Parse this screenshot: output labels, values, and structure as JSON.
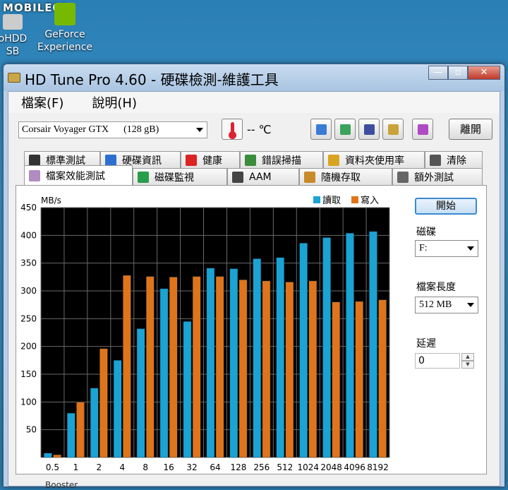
{
  "desktop": {
    "watermark": "MOBILE01",
    "icons": [
      {
        "label_line1": "oHDD",
        "label_line2": "SB"
      },
      {
        "label_line1": "GeForce",
        "label_line2": "Experience"
      }
    ],
    "bottom_text": "Booster"
  },
  "window": {
    "title": "HD Tune Pro 4.60 - 硬碟檢測-維護工具",
    "buttons": {
      "minimize": "—",
      "maximize": "▫",
      "close": "✕"
    }
  },
  "menu": [
    "檔案(F)",
    "說明(H)"
  ],
  "toolbar": {
    "drive": "Corsair Voyager GTX      (128 gB)",
    "temperature": "-- ℃",
    "exit_label": "離開",
    "icon_colors": [
      "#3a7bd5",
      "#3aa35a",
      "#3d4f9e",
      "#c9a23a",
      "#b04ac4"
    ]
  },
  "tabs_top": [
    {
      "label": "標準測試",
      "icon": "trophy-icon"
    },
    {
      "label": "硬碟資訊",
      "icon": "info-icon"
    },
    {
      "label": "健康",
      "icon": "health-cross-icon"
    },
    {
      "label": "錯誤掃描",
      "icon": "magnifier-icon"
    },
    {
      "label": "資料夾使用率",
      "icon": "folder-icon"
    },
    {
      "label": "清除",
      "icon": "trash-icon"
    }
  ],
  "tabs_bottom": [
    {
      "label": "檔案效能測試",
      "icon": "file-benchmark-icon",
      "active": true
    },
    {
      "label": "磁碟監視",
      "icon": "monitor-chart-icon"
    },
    {
      "label": "AAM",
      "icon": "speaker-icon"
    },
    {
      "label": "隨機存取",
      "icon": "random-access-icon"
    },
    {
      "label": "額外測試",
      "icon": "extra-tests-icon"
    }
  ],
  "side": {
    "start_label": "開始",
    "disk_label": "磁碟",
    "disk_value": "F:",
    "length_label": "檔案長度",
    "length_value": "512 MB",
    "delay_label": "延遲",
    "delay_value": "0"
  },
  "chart_data": {
    "type": "bar",
    "ylabel": "MB/s",
    "ylim": [
      0,
      450
    ],
    "yticks": [
      50,
      100,
      150,
      200,
      250,
      300,
      350,
      400,
      450
    ],
    "categories": [
      "0.5",
      "1",
      "2",
      "4",
      "8",
      "16",
      "32",
      "64",
      "128",
      "256",
      "512",
      "1024",
      "2048",
      "4096",
      "8192"
    ],
    "series": [
      {
        "name": "讀取",
        "color": "#1ba3d4",
        "values": [
          8,
          80,
          125,
          175,
          232,
          304,
          245,
          341,
          340,
          358,
          360,
          386,
          396,
          404,
          407
        ]
      },
      {
        "name": "寫入",
        "color": "#e0741a",
        "values": [
          5,
          100,
          196,
          328,
          326,
          325,
          326,
          326,
          320,
          318,
          316,
          318,
          280,
          281,
          284
        ]
      }
    ],
    "grid": true,
    "legend": "top-right",
    "background": "#000000"
  }
}
